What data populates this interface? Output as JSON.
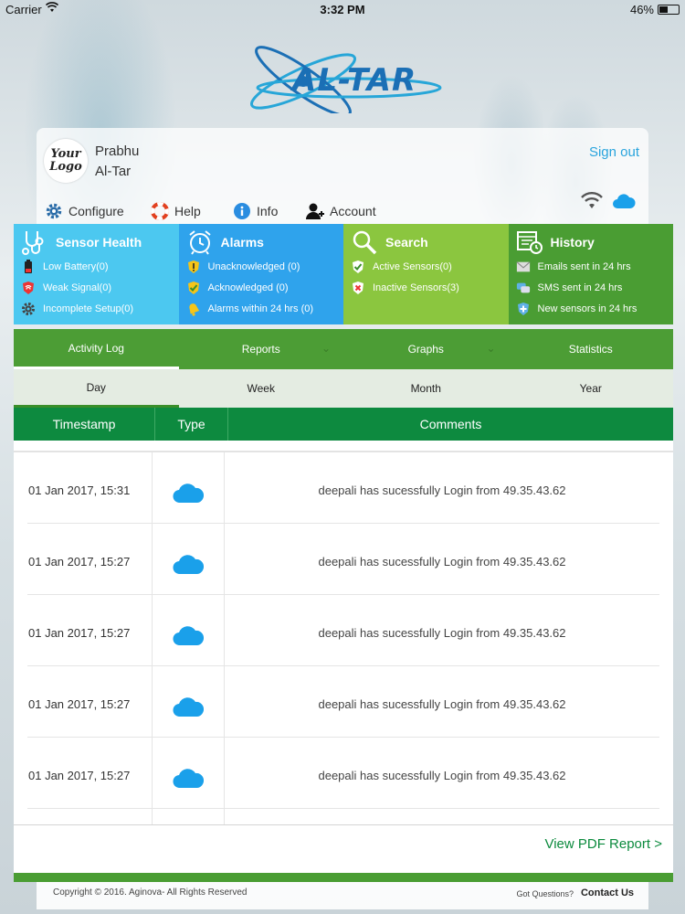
{
  "status_bar": {
    "carrier": "Carrier",
    "time": "3:32 PM",
    "battery": "46%",
    "battery_level": 0.46
  },
  "brand": {
    "logo_text": "AL-TAR"
  },
  "header": {
    "your_logo_line1": "Your",
    "your_logo_line2": "Logo",
    "user_first": "Prabhu",
    "user_org": "Al-Tar",
    "signout": "Sign out",
    "nav": [
      {
        "label": "Configure",
        "icon": "gear-icon"
      },
      {
        "label": "Help",
        "icon": "lifebuoy-icon"
      },
      {
        "label": "Info",
        "icon": "info-icon"
      },
      {
        "label": "Account",
        "icon": "account-icon"
      }
    ]
  },
  "panels": {
    "sensor": {
      "title": "Sensor Health",
      "rows": [
        "Low Battery(0)",
        "Weak Signal(0)",
        "Incomplete Setup(0)"
      ]
    },
    "alarms": {
      "title": "Alarms",
      "rows": [
        "Unacknowledged (0)",
        "Acknowledged (0)",
        "Alarms within 24 hrs (0)"
      ]
    },
    "search": {
      "title": "Search",
      "rows": [
        "Active Sensors(0)",
        "Inactive Sensors(3)"
      ]
    },
    "history": {
      "title": "History",
      "rows": [
        "Emails sent in 24 hrs",
        "SMS sent in 24 hrs",
        "New sensors in 24 hrs"
      ]
    }
  },
  "tabs": [
    "Activity Log",
    "Reports",
    "Graphs",
    "Statistics"
  ],
  "periods": [
    "Day",
    "Week",
    "Month",
    "Year"
  ],
  "table": {
    "headers": [
      "Timestamp",
      "Type",
      "Comments"
    ],
    "rows": [
      {
        "timestamp": "01 Jan 2017, 15:31",
        "type": "cloud-icon",
        "comment": "deepali has sucessfully Login from 49.35.43.62"
      },
      {
        "timestamp": "01 Jan 2017, 15:27",
        "type": "cloud-icon",
        "comment": "deepali has sucessfully Login from 49.35.43.62"
      },
      {
        "timestamp": "01 Jan 2017, 15:27",
        "type": "cloud-icon",
        "comment": "deepali has sucessfully Login from 49.35.43.62"
      },
      {
        "timestamp": "01 Jan 2017, 15:27",
        "type": "cloud-icon",
        "comment": "deepali has sucessfully Login from 49.35.43.62"
      },
      {
        "timestamp": "01 Jan 2017, 15:27",
        "type": "cloud-icon",
        "comment": "deepali has sucessfully Login from 49.35.43.62"
      }
    ],
    "pdf_link": "View PDF Report >"
  },
  "footer": {
    "copyright": "Copyright © 2016. Aginova- All Rights Reserved",
    "questions": "Got Questions?",
    "contact": "Contact Us"
  },
  "colors": {
    "sensor_panel": "#4cc8f0",
    "alarms_panel": "#2fa3ec",
    "search_panel": "#8bc63f",
    "history_panel": "#4a9d33",
    "table_header": "#0d8a3f",
    "link_blue": "#29a4dd",
    "cloud_blue": "#1aa0ea"
  }
}
